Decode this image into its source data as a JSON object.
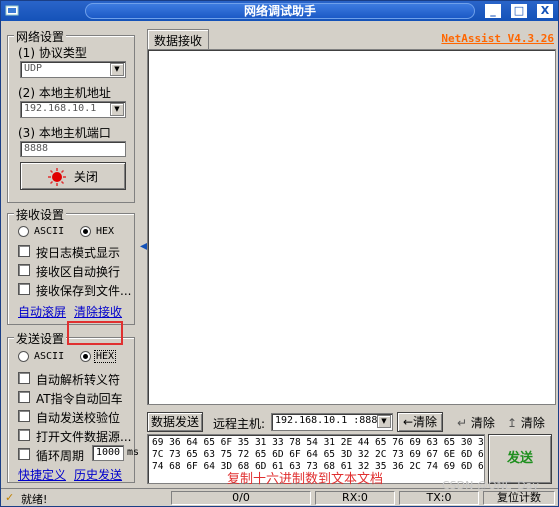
{
  "window": {
    "title": "网络调试助手",
    "controls": {
      "minimize": "_",
      "maximize": "□",
      "close": "X"
    }
  },
  "network": {
    "group_title": "网络设置",
    "protocol_label": "(1) 协议类型",
    "protocol_value": "UDP",
    "local_ip_label": "(2) 本地主机地址",
    "local_ip_value": "192.168.10.1",
    "local_port_label": "(3) 本地主机端口",
    "local_port_value": "8888",
    "close_button": "关闭"
  },
  "receive": {
    "group_title": "接收设置",
    "ascii_label": "ASCII",
    "hex_label": "HEX",
    "selected": "HEX",
    "options": [
      "按日志模式显示",
      "接收区自动换行",
      "接收保存到文件..."
    ],
    "auto_scroll": "自动滚屏",
    "clear_receive": "清除接收"
  },
  "send": {
    "group_title": "发送设置",
    "ascii_label": "ASCII",
    "hex_label": "HEX",
    "selected": "HEX",
    "options": [
      "自动解析转义符",
      "AT指令自动回车",
      "自动发送校验位",
      "打开文件数据源..."
    ],
    "loop_label": "循环周期",
    "loop_value": "1000",
    "loop_unit": "ms",
    "shortcut": "快捷定义",
    "history": "历史发送"
  },
  "main": {
    "receive_tab": "数据接收",
    "brand": "NetAssist V4.3.26",
    "send_tab": "数据发送",
    "remote_label": "远程主机:",
    "remote_value": "192.168.10.1 :888",
    "clear1": "清除",
    "clear2": "清除",
    "clear3": "清除",
    "send_lines": [
      "69 36 64 65 6F 35 31 33 78 54 31 2E 44 65 76 69 63 65 30 31",
      "7C 73 65 63 75 72 65 6D 6F 64 65 3D 32 2C 73 69 67 6E 6D 65",
      "74 68 6F 64 3D 68 6D 61 63 73 68 61 32 35 36 2C 74 69 6D 65"
    ],
    "send_button": "发送",
    "overlay_note": "复制十六进制数到文本文档"
  },
  "status": {
    "ready": "就绪!",
    "count": "0/0",
    "rx": "RX:0",
    "tx": "TX:0",
    "reset": "复位计数"
  },
  "watermark": "CSDN @ONE_Day"
}
